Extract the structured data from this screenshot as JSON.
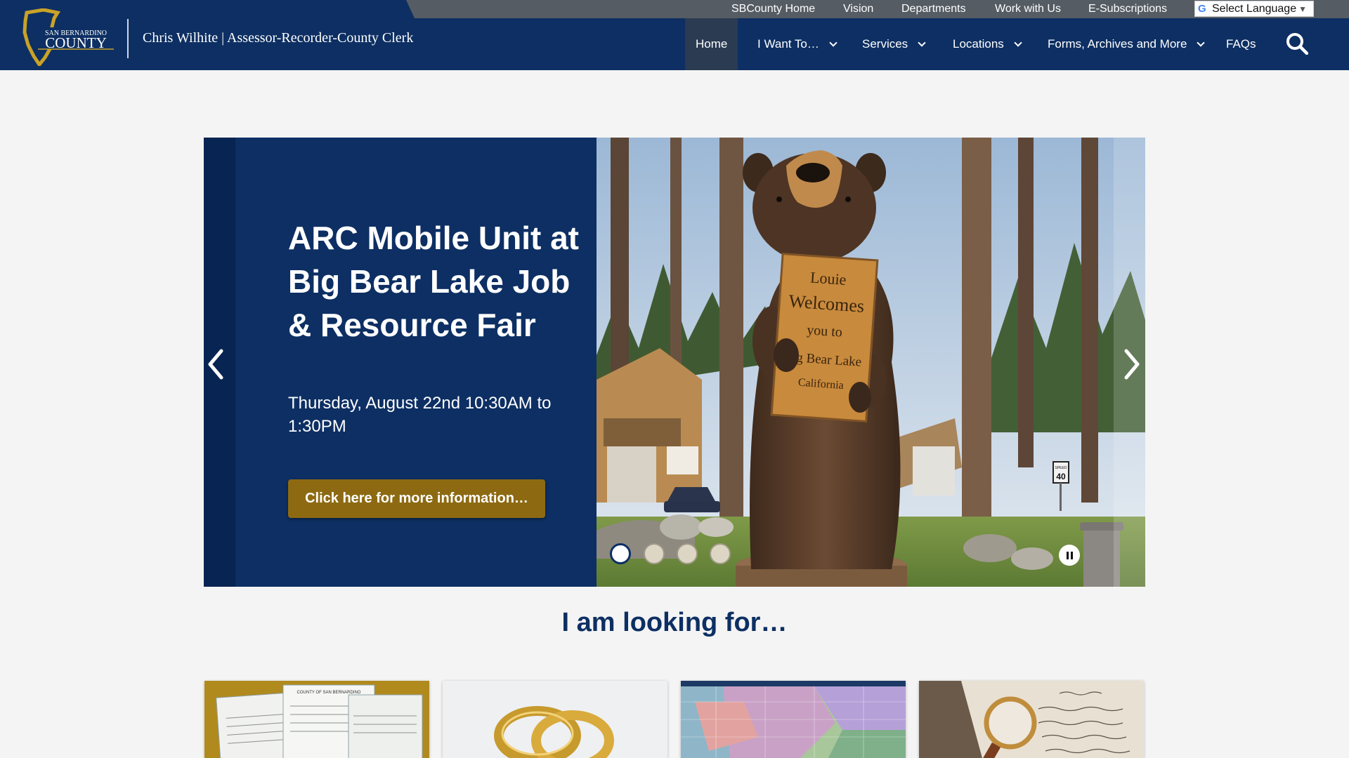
{
  "utility_nav": [
    "SBCounty Home",
    "Vision",
    "Departments",
    "Work with Us",
    "E-Subscriptions"
  ],
  "language": {
    "label": "Select Language",
    "arrow": "▼",
    "g_icon": "G"
  },
  "logo": {
    "line1": "SAN BERNARDINO",
    "line2": "COUNTY"
  },
  "site_title": "Chris Wilhite | Assessor-Recorder-County Clerk",
  "main_nav": [
    "Home",
    "I Want To…",
    "Services",
    "Locations",
    "Forms, Archives and More",
    "FAQs"
  ],
  "hero": {
    "title": "ARC Mobile Unit at Big Bear Lake Job & Resource Fair",
    "subtitle": "Thursday, August 22nd 10:30AM to 1:30PM",
    "button": "Click here for more information…",
    "sign": [
      "Louie",
      "Welcomes",
      "you to",
      "Big Bear Lake",
      "California"
    ],
    "road_sign": [
      "SPEED",
      "40"
    ]
  },
  "carousel": {
    "slide_count": 4,
    "active": 1
  },
  "section_title": "I am looking for…",
  "cards": [
    {
      "icon": "certificate-image",
      "label": "COUNTY OF SAN BERNARDINO"
    },
    {
      "icon": "wedding-rings-image"
    },
    {
      "icon": "county-map-image"
    },
    {
      "icon": "magnifying-glass-document-image"
    }
  ],
  "colors": {
    "navy": "#0d2f63",
    "gold": "#8d6a12",
    "utility_bar": "#555c63",
    "active_nav": "#2a3b52"
  }
}
